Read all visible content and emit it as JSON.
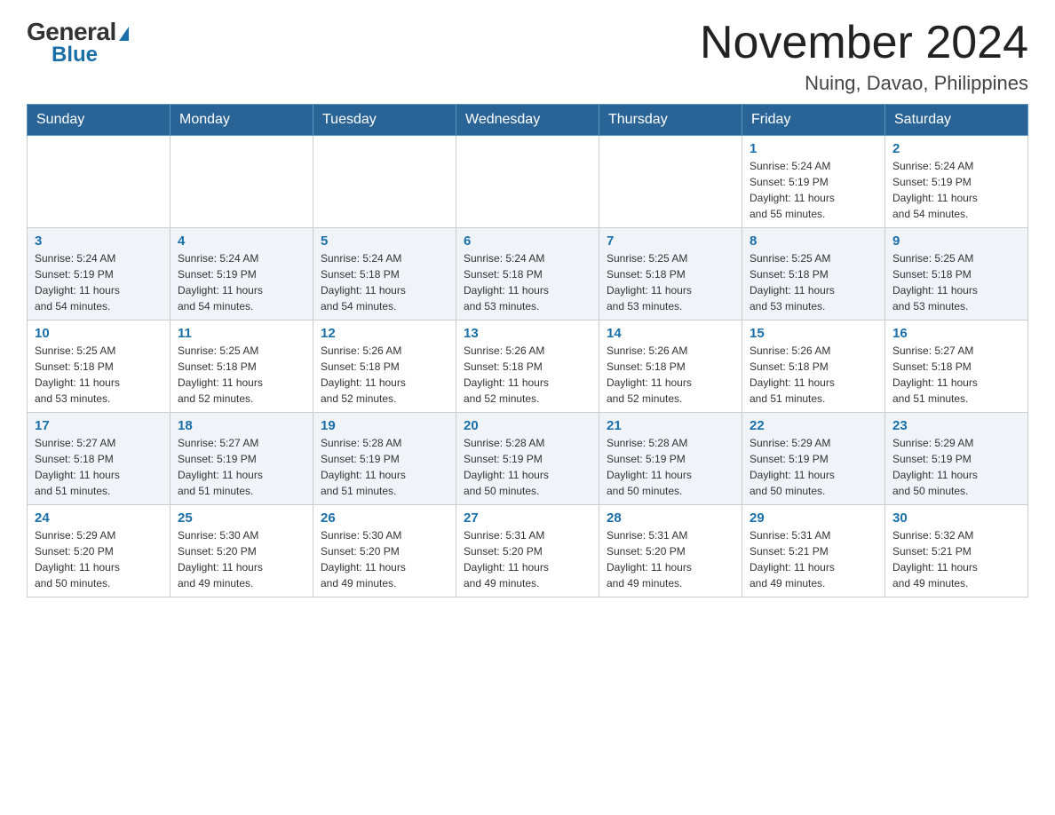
{
  "logo": {
    "general": "General",
    "blue": "Blue",
    "triangle": "▶"
  },
  "header": {
    "month_year": "November 2024",
    "location": "Nuing, Davao, Philippines"
  },
  "weekdays": [
    "Sunday",
    "Monday",
    "Tuesday",
    "Wednesday",
    "Thursday",
    "Friday",
    "Saturday"
  ],
  "weeks": [
    {
      "days": [
        {
          "num": "",
          "info": ""
        },
        {
          "num": "",
          "info": ""
        },
        {
          "num": "",
          "info": ""
        },
        {
          "num": "",
          "info": ""
        },
        {
          "num": "",
          "info": ""
        },
        {
          "num": "1",
          "info": "Sunrise: 5:24 AM\nSunset: 5:19 PM\nDaylight: 11 hours\nand 55 minutes."
        },
        {
          "num": "2",
          "info": "Sunrise: 5:24 AM\nSunset: 5:19 PM\nDaylight: 11 hours\nand 54 minutes."
        }
      ]
    },
    {
      "days": [
        {
          "num": "3",
          "info": "Sunrise: 5:24 AM\nSunset: 5:19 PM\nDaylight: 11 hours\nand 54 minutes."
        },
        {
          "num": "4",
          "info": "Sunrise: 5:24 AM\nSunset: 5:19 PM\nDaylight: 11 hours\nand 54 minutes."
        },
        {
          "num": "5",
          "info": "Sunrise: 5:24 AM\nSunset: 5:18 PM\nDaylight: 11 hours\nand 54 minutes."
        },
        {
          "num": "6",
          "info": "Sunrise: 5:24 AM\nSunset: 5:18 PM\nDaylight: 11 hours\nand 53 minutes."
        },
        {
          "num": "7",
          "info": "Sunrise: 5:25 AM\nSunset: 5:18 PM\nDaylight: 11 hours\nand 53 minutes."
        },
        {
          "num": "8",
          "info": "Sunrise: 5:25 AM\nSunset: 5:18 PM\nDaylight: 11 hours\nand 53 minutes."
        },
        {
          "num": "9",
          "info": "Sunrise: 5:25 AM\nSunset: 5:18 PM\nDaylight: 11 hours\nand 53 minutes."
        }
      ]
    },
    {
      "days": [
        {
          "num": "10",
          "info": "Sunrise: 5:25 AM\nSunset: 5:18 PM\nDaylight: 11 hours\nand 53 minutes."
        },
        {
          "num": "11",
          "info": "Sunrise: 5:25 AM\nSunset: 5:18 PM\nDaylight: 11 hours\nand 52 minutes."
        },
        {
          "num": "12",
          "info": "Sunrise: 5:26 AM\nSunset: 5:18 PM\nDaylight: 11 hours\nand 52 minutes."
        },
        {
          "num": "13",
          "info": "Sunrise: 5:26 AM\nSunset: 5:18 PM\nDaylight: 11 hours\nand 52 minutes."
        },
        {
          "num": "14",
          "info": "Sunrise: 5:26 AM\nSunset: 5:18 PM\nDaylight: 11 hours\nand 52 minutes."
        },
        {
          "num": "15",
          "info": "Sunrise: 5:26 AM\nSunset: 5:18 PM\nDaylight: 11 hours\nand 51 minutes."
        },
        {
          "num": "16",
          "info": "Sunrise: 5:27 AM\nSunset: 5:18 PM\nDaylight: 11 hours\nand 51 minutes."
        }
      ]
    },
    {
      "days": [
        {
          "num": "17",
          "info": "Sunrise: 5:27 AM\nSunset: 5:18 PM\nDaylight: 11 hours\nand 51 minutes."
        },
        {
          "num": "18",
          "info": "Sunrise: 5:27 AM\nSunset: 5:19 PM\nDaylight: 11 hours\nand 51 minutes."
        },
        {
          "num": "19",
          "info": "Sunrise: 5:28 AM\nSunset: 5:19 PM\nDaylight: 11 hours\nand 51 minutes."
        },
        {
          "num": "20",
          "info": "Sunrise: 5:28 AM\nSunset: 5:19 PM\nDaylight: 11 hours\nand 50 minutes."
        },
        {
          "num": "21",
          "info": "Sunrise: 5:28 AM\nSunset: 5:19 PM\nDaylight: 11 hours\nand 50 minutes."
        },
        {
          "num": "22",
          "info": "Sunrise: 5:29 AM\nSunset: 5:19 PM\nDaylight: 11 hours\nand 50 minutes."
        },
        {
          "num": "23",
          "info": "Sunrise: 5:29 AM\nSunset: 5:19 PM\nDaylight: 11 hours\nand 50 minutes."
        }
      ]
    },
    {
      "days": [
        {
          "num": "24",
          "info": "Sunrise: 5:29 AM\nSunset: 5:20 PM\nDaylight: 11 hours\nand 50 minutes."
        },
        {
          "num": "25",
          "info": "Sunrise: 5:30 AM\nSunset: 5:20 PM\nDaylight: 11 hours\nand 49 minutes."
        },
        {
          "num": "26",
          "info": "Sunrise: 5:30 AM\nSunset: 5:20 PM\nDaylight: 11 hours\nand 49 minutes."
        },
        {
          "num": "27",
          "info": "Sunrise: 5:31 AM\nSunset: 5:20 PM\nDaylight: 11 hours\nand 49 minutes."
        },
        {
          "num": "28",
          "info": "Sunrise: 5:31 AM\nSunset: 5:20 PM\nDaylight: 11 hours\nand 49 minutes."
        },
        {
          "num": "29",
          "info": "Sunrise: 5:31 AM\nSunset: 5:21 PM\nDaylight: 11 hours\nand 49 minutes."
        },
        {
          "num": "30",
          "info": "Sunrise: 5:32 AM\nSunset: 5:21 PM\nDaylight: 11 hours\nand 49 minutes."
        }
      ]
    }
  ]
}
